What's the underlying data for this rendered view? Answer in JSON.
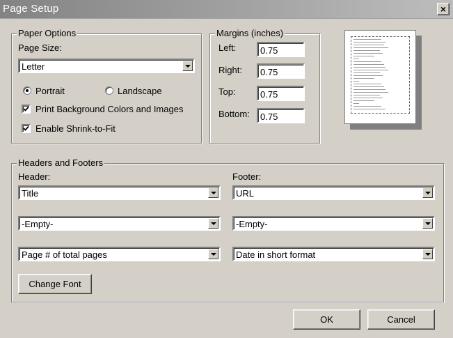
{
  "window": {
    "title": "Page Setup",
    "close_label": "×"
  },
  "paper_options": {
    "legend": "Paper Options",
    "page_size_label": "Page Size:",
    "page_size_value": "Letter",
    "portrait_label": "Portrait",
    "landscape_label": "Landscape",
    "orientation_selected": "Portrait",
    "print_background_label": "Print Background Colors and Images",
    "print_background_checked": true,
    "shrink_label": "Enable Shrink-to-Fit",
    "shrink_checked": true
  },
  "margins": {
    "legend": "Margins (inches)",
    "left_label": "Left:",
    "left_value": "0.75",
    "right_label": "Right:",
    "right_value": "0.75",
    "top_label": "Top:",
    "top_value": "0.75",
    "bottom_label": "Bottom:",
    "bottom_value": "0.75"
  },
  "headers_footers": {
    "legend": "Headers and Footers",
    "header_label": "Header:",
    "footer_label": "Footer:",
    "header_values": [
      "Title",
      "-Empty-",
      "Page # of total pages"
    ],
    "footer_values": [
      "URL",
      "-Empty-",
      "Date in short format"
    ],
    "change_font_label": "Change Font"
  },
  "buttons": {
    "ok_label": "OK",
    "cancel_label": "Cancel"
  }
}
